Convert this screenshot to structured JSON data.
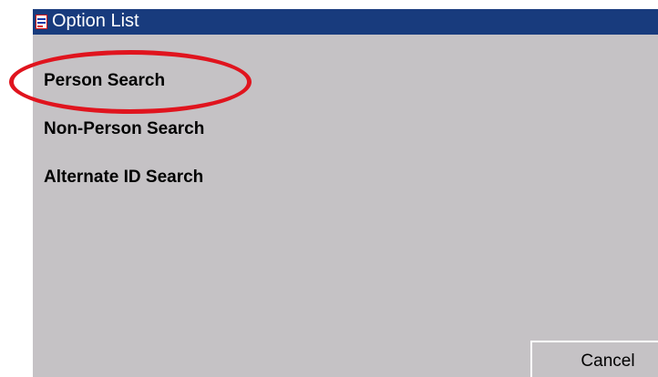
{
  "window": {
    "title": "Option List",
    "title_icon": "form-document-icon"
  },
  "options": {
    "items": [
      {
        "label": "Person Search"
      },
      {
        "label": "Non-Person Search"
      },
      {
        "label": "Alternate ID Search"
      }
    ],
    "highlighted_index": 0
  },
  "buttons": {
    "cancel_label": "Cancel"
  },
  "colors": {
    "titlebar": "#183b7d",
    "titlebar_text": "#ffffff",
    "window_background": "#c5c2c5",
    "highlight_ring": "#e0141e",
    "text": "#000000"
  }
}
